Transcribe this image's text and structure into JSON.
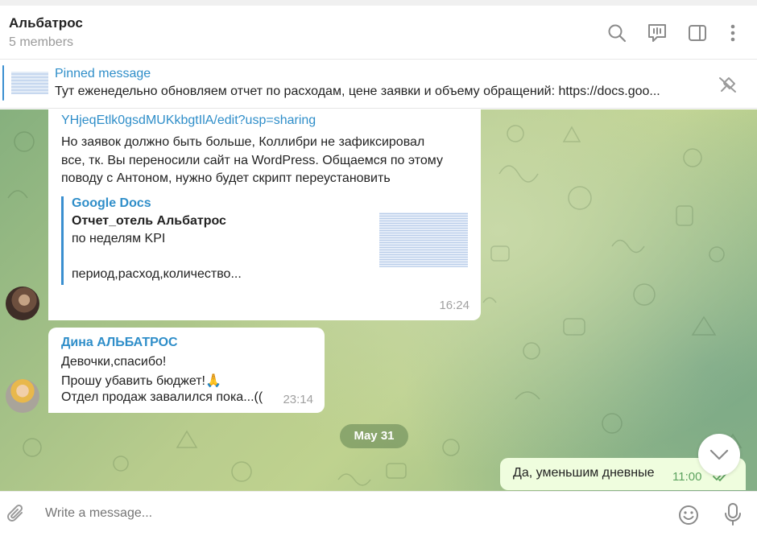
{
  "header": {
    "title": "Альбатрос",
    "subtitle": "5 members",
    "icons": [
      "search-icon",
      "video-chat-icon",
      "sidebar-toggle-icon",
      "more-vertical-icon"
    ]
  },
  "pinned": {
    "label": "Pinned message",
    "text": "Тут еженедельно обновляем отчет по расходам, цене заявки и объему обращений: https://docs.goo..."
  },
  "messages": {
    "m1": {
      "link_tail": "YHjeqEtlk0gsdMUKkbgtIlA/edit?usp=sharing",
      "body_lines": [
        "Но заявок должно быть больше, Коллибри не зафиксировал",
        "все, тк. Вы переносили сайт на WordPress. Общаемся по этому",
        "поводу с Антоном, нужно будет скрипт переустановить"
      ],
      "preview": {
        "site": "Google Docs",
        "title": "Отчет_отель Альбатрос",
        "desc1": "по неделям KPI",
        "desc2": "период,расход,количество..."
      },
      "time": "16:24"
    },
    "m2": {
      "sender": "Дина АЛЬБАТРОС",
      "lines": [
        "Девочки,спасибо!",
        "Прошу убавить бюджет!🙏",
        "Отдел продаж завалился пока...(("
      ],
      "time": "23:14"
    },
    "date_separator": "May 31",
    "m3": {
      "text": "Да, уменьшим дневные",
      "time": "11:00"
    }
  },
  "composer": {
    "placeholder": "Write a message..."
  },
  "colors": {
    "accent": "#2f8ec9",
    "outgoing_bubble": "#effdde",
    "read_check": "#5da35f"
  }
}
